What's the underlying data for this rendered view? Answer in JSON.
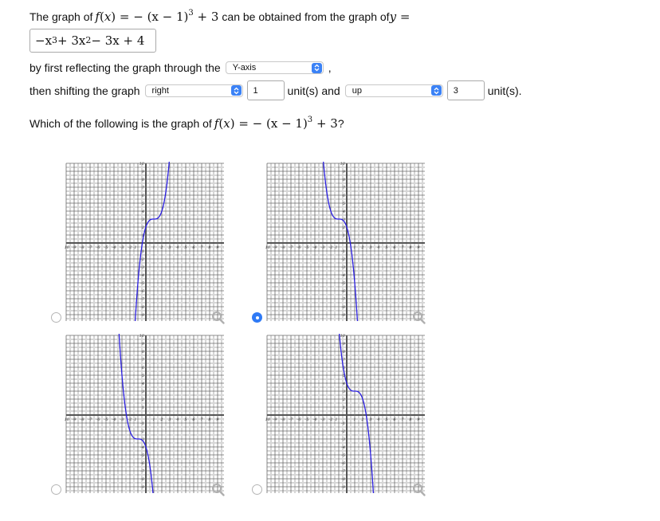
{
  "question": {
    "line1_prefix": "The graph of ",
    "f_label": "f",
    "x_var": "x",
    "line1_eq_rhs": "= − (x − 1)",
    "cube": "3",
    "plus_three": " + 3",
    "line1_suffix": " can be obtained from the graph of ",
    "y_var": "y",
    "equals": " =",
    "base_function": {
      "t1": "−x",
      "e1": "3",
      "t2": " + 3x",
      "e2": "2",
      "t3": " − 3x + 4"
    },
    "line2_text": "by first reflecting the graph through the",
    "line2_tail": ",",
    "line3_text": "then shifting the graph",
    "unit_and": "unit(s) and",
    "unit_end": "unit(s).",
    "prompt_prefix": "Which of the following is the graph of ",
    "prompt_suffix": " ?"
  },
  "controls": {
    "reflect_select": {
      "value": "Y-axis"
    },
    "horizontal_select": {
      "value": "right"
    },
    "horizontal_amount": "1",
    "vertical_select": {
      "value": "up"
    },
    "vertical_amount": "3"
  },
  "options": [
    {
      "id": "A",
      "selected": false,
      "function": "(x-1)^3+3",
      "h": 1,
      "k": 3,
      "sign": 1
    },
    {
      "id": "B",
      "selected": true,
      "function": "-(x+1)^3+3",
      "h": -1,
      "k": 3,
      "sign": -1
    },
    {
      "id": "C",
      "selected": false,
      "function": "-(x+1)^3-3",
      "h": -1,
      "k": -3,
      "sign": -1
    },
    {
      "id": "D",
      "selected": false,
      "function": "-(x-1)^3+3",
      "h": 1,
      "k": 3,
      "sign": -1
    }
  ],
  "graph_axes": {
    "xmin": -10,
    "xmax": 10,
    "ymin": -10,
    "ymax": 10,
    "x_ticks": [
      "-10",
      "-9",
      "-8",
      "-7",
      "-6",
      "-5",
      "-4",
      "-3",
      "-2",
      "-1",
      "1",
      "2",
      "3",
      "4",
      "5",
      "6",
      "7",
      "8",
      "9",
      "10"
    ],
    "y_ticks": [
      "10",
      "9",
      "8",
      "7",
      "6",
      "5",
      "4",
      "3",
      "2",
      "1",
      "-1",
      "-2",
      "-3",
      "-4",
      "-5",
      "-6",
      "-7",
      "-8",
      "-9",
      "-10"
    ]
  },
  "colors": {
    "curve": "#2b1fe0",
    "radio_selected": "#2f7af5",
    "select_arrow": "#3b82f6"
  }
}
